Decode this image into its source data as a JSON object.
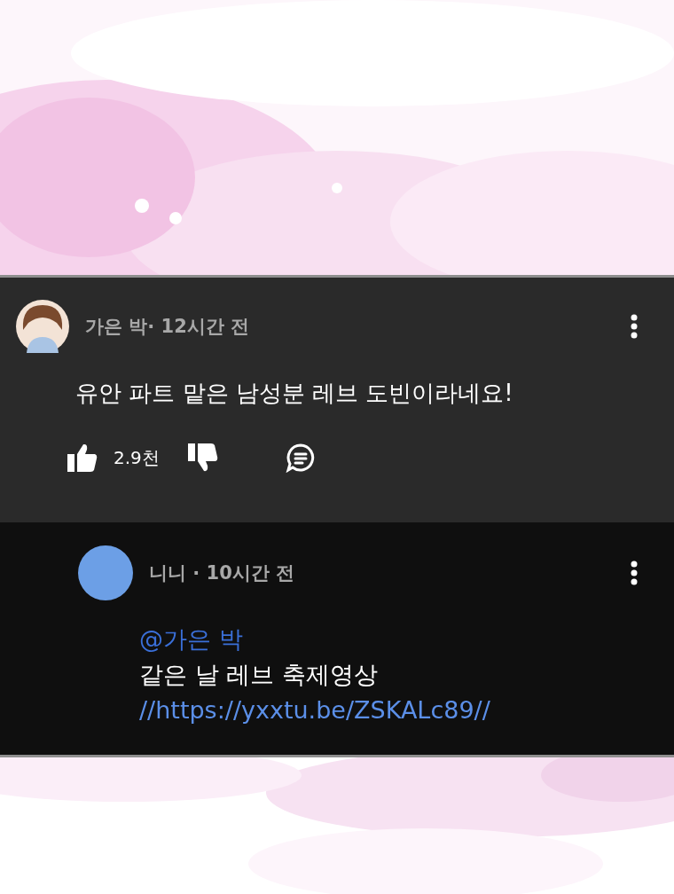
{
  "comment": {
    "meta": "가은 박· 12시간 전",
    "text": "유안 파트 맡은 남성분 레브 도빈이라네요!",
    "likes": "2.9천"
  },
  "reply": {
    "meta": "니니 · 10시간 전",
    "mention": "@가은 박",
    "text": "같은 날 레브 축제영상",
    "link": "//https://yxxtu.be/ZSKALc89//"
  }
}
